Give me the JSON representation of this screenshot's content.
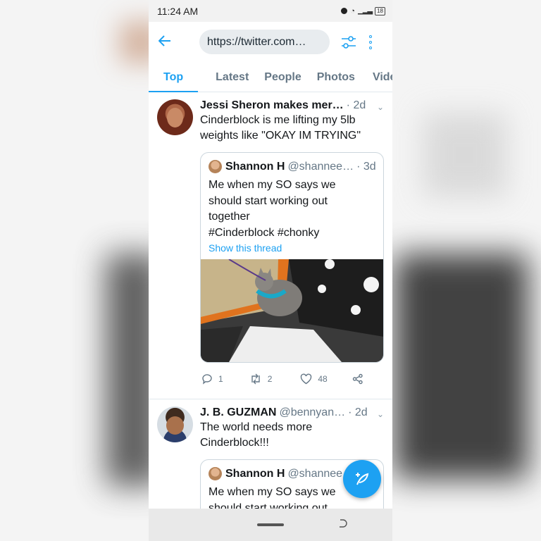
{
  "status_bar": {
    "time": "11:24 AM",
    "battery": "18"
  },
  "toolbar": {
    "url": "https://twitter.com…"
  },
  "tabs": [
    {
      "label": "Top"
    },
    {
      "label": "Latest"
    },
    {
      "label": "People"
    },
    {
      "label": "Photos"
    },
    {
      "label": "Video"
    }
  ],
  "tweets": [
    {
      "name": "Jessi Sheron makes mer…",
      "handle": "",
      "time": "· 2d",
      "text": "Cinderblock is me lifting my 5lb weights like \"OKAY IM TRYING\"",
      "quote": {
        "name": "Shannon H",
        "handle": "@shannee…",
        "time": "· 3d",
        "text_lines": [
          "Me when my SO says we",
          "should start working out",
          "together",
          "#Cinderblock #chonky"
        ],
        "link": "Show this thread"
      },
      "replies": "1",
      "retweets": "2",
      "likes": "48"
    },
    {
      "name": "J. B. GUZMAN",
      "handle": "@bennyan…",
      "time": "· 2d",
      "text": "The world needs more Cinderblock!!!",
      "quote": {
        "name": "Shannon H",
        "handle": "@shannee…",
        "time": "",
        "text_lines": [
          "Me when my SO says we",
          "should start working out"
        ]
      }
    }
  ],
  "colors": {
    "accent": "#1da1f2",
    "text": "#14171a",
    "muted": "#657786"
  },
  "icons": [
    "back-arrow-icon",
    "filter-icon",
    "more-vert-icon",
    "chevron-down-icon",
    "reply-icon",
    "retweet-icon",
    "like-icon",
    "share-icon",
    "compose-icon"
  ]
}
